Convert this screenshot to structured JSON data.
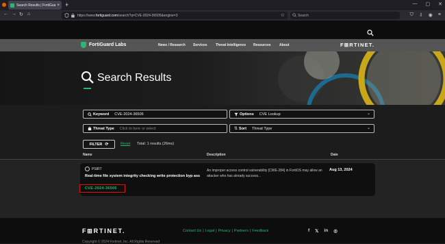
{
  "browser": {
    "tab_title": "Search Results | FortiGuard Labs",
    "tab_close": "×",
    "new_tab": "+",
    "url_prefix": "https://www.",
    "url_domain": "fortiguard.com",
    "url_rest": "/search?q=CVE-2024-36505&engine=3",
    "search_placeholder": "Search",
    "window_controls": [
      "—",
      "▢",
      "✕"
    ]
  },
  "site": {
    "logo_text": "FortiGuard Labs",
    "nav": [
      "News / Research",
      "Services",
      "Threat Intelligence",
      "Resources",
      "About"
    ],
    "brand": "F⊞RTINET."
  },
  "hero": {
    "title": "Search Results"
  },
  "search": {
    "keyword_label": "Keyword",
    "keyword_value": "CVE-2024-36505",
    "options_label": "Options",
    "options_value": "CVE Lookup",
    "threat_label": "Threat Type",
    "threat_placeholder": "Click to here or select",
    "sort_label": "Sort",
    "sort_value": "Threat Type",
    "filter_label": "FILTER",
    "reset_label": "Reset",
    "total_text": "Total: 1 results (26ms)"
  },
  "table": {
    "headers": [
      "Name",
      "Description",
      "Date"
    ]
  },
  "result": {
    "source": "PSIRT",
    "title": "Real-time file system integrity checking write protection byp ass",
    "cve": "CVE-2024-36505",
    "description": "An improper access control vulnerability [CWE-284] in FortiOS may allow an attacker who has already success...",
    "date": "Aug 13, 2024",
    "highlight_color": "#e01010"
  },
  "footer": {
    "brand": "F⊞RTINET.",
    "links": [
      "Contact Us",
      "Legal",
      "Privacy",
      "Partners",
      "Feedback"
    ],
    "social": [
      "f",
      "𝕏",
      "in",
      "◎"
    ],
    "copyright": "Copyright © 2024 Fortinet, Inc. All Rights Reserved"
  },
  "colors": {
    "accent": "#2bb673",
    "background": "#1c1c1c"
  }
}
